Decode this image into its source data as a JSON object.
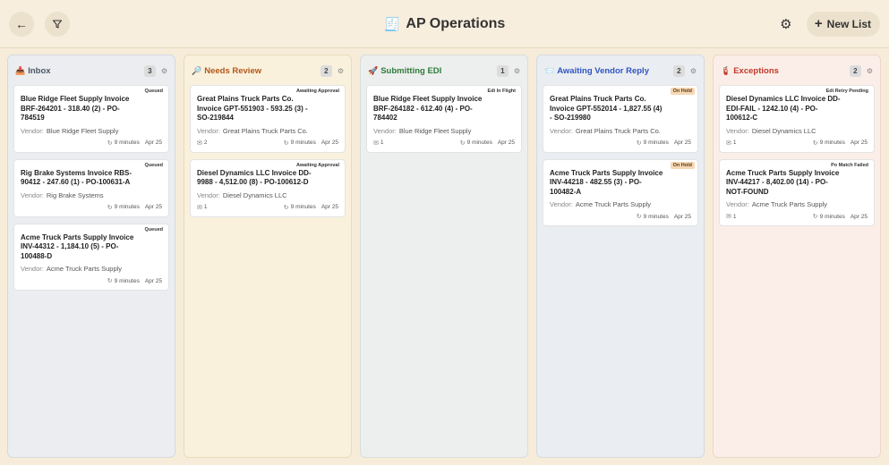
{
  "header": {
    "title_icon": "receipt-icon",
    "title": "AP Operations",
    "new_list_label": "New List"
  },
  "vendor_label": "Vendor:",
  "columns": [
    {
      "title": "Inbox",
      "count": "3",
      "icon": "inbox-icon",
      "cards": [
        {
          "tag": "Queued",
          "title": "Blue Ridge Fleet Supply Invoice BRF-264201 - 318.40 (2) - PO-784519",
          "vendor": "Blue Ridge Fleet Supply",
          "time": "9 minutes",
          "date": "Apr 25"
        },
        {
          "tag": "Queued",
          "title": "Rig Brake Systems Invoice RBS-90412 - 247.60 (1) - PO-100631-A",
          "vendor": "Rig Brake Systems",
          "time": "9 minutes",
          "date": "Apr 25"
        },
        {
          "tag": "Queued",
          "title": "Acme Truck Parts Supply Invoice INV-44312 - 1,184.10 (5) - PO-100488-D",
          "vendor": "Acme Truck Parts Supply",
          "time": "9 minutes",
          "date": "Apr 25"
        }
      ]
    },
    {
      "title": "Needs Review",
      "count": "2",
      "icon": "magnifier-icon",
      "cards": [
        {
          "tag": "Awaiting Approval",
          "title": "Great Plains Truck Parts Co. Invoice GPT-551903 - 593.25 (3) - SO-219844",
          "vendor": "Great Plains Truck Parts Co.",
          "attach": "2",
          "time": "9 minutes",
          "date": "Apr 25"
        },
        {
          "tag": "Awaiting Approval",
          "title": "Diesel Dynamics LLC Invoice DD-9988 - 4,512.00 (8) - PO-100612-D",
          "vendor": "Diesel Dynamics LLC",
          "attach": "1",
          "time": "9 minutes",
          "date": "Apr 25"
        }
      ]
    },
    {
      "title": "Submitting EDI",
      "count": "1",
      "icon": "rocket-icon",
      "cards": [
        {
          "tag": "Edi In Flight",
          "title": "Blue Ridge Fleet Supply Invoice BRF-264182 - 612.40 (4) - PO-784402",
          "vendor": "Blue Ridge Fleet Supply",
          "attach": "1",
          "time": "9 minutes",
          "date": "Apr 25"
        }
      ]
    },
    {
      "title": "Awaiting Vendor Reply",
      "count": "2",
      "icon": "envelope-icon",
      "cards": [
        {
          "tag": "On Hold",
          "title": "Great Plains Truck Parts Co. Invoice GPT-552014 - 1,827.55 (4) - SO-219980",
          "vendor": "Great Plains Truck Parts Co.",
          "time": "9 minutes",
          "date": "Apr 25"
        },
        {
          "tag": "On Hold",
          "title": "Acme Truck Parts Supply Invoice INV-44218 - 482.55 (3) - PO-100482-A",
          "vendor": "Acme Truck Parts Supply",
          "time": "9 minutes",
          "date": "Apr 25"
        }
      ]
    },
    {
      "title": "Exceptions",
      "count": "2",
      "icon": "alert-icon",
      "cards": [
        {
          "tag": "Edi Retry Pending",
          "title": "Diesel Dynamics LLC Invoice DD-EDI-FAIL - 1242.10 (4) - PO-100612-C",
          "vendor": "Diesel Dynamics LLC",
          "attach": "1",
          "time": "9 minutes",
          "date": "Apr 25"
        },
        {
          "tag": "Po Match Failed",
          "title": "Acme Truck Parts Supply Invoice INV-44217 - 8,402.00 (14) - PO-NOT-FOUND",
          "vendor": "Acme Truck Parts Supply",
          "attach": "1",
          "time": "9 minutes",
          "date": "Apr 25"
        }
      ]
    }
  ]
}
